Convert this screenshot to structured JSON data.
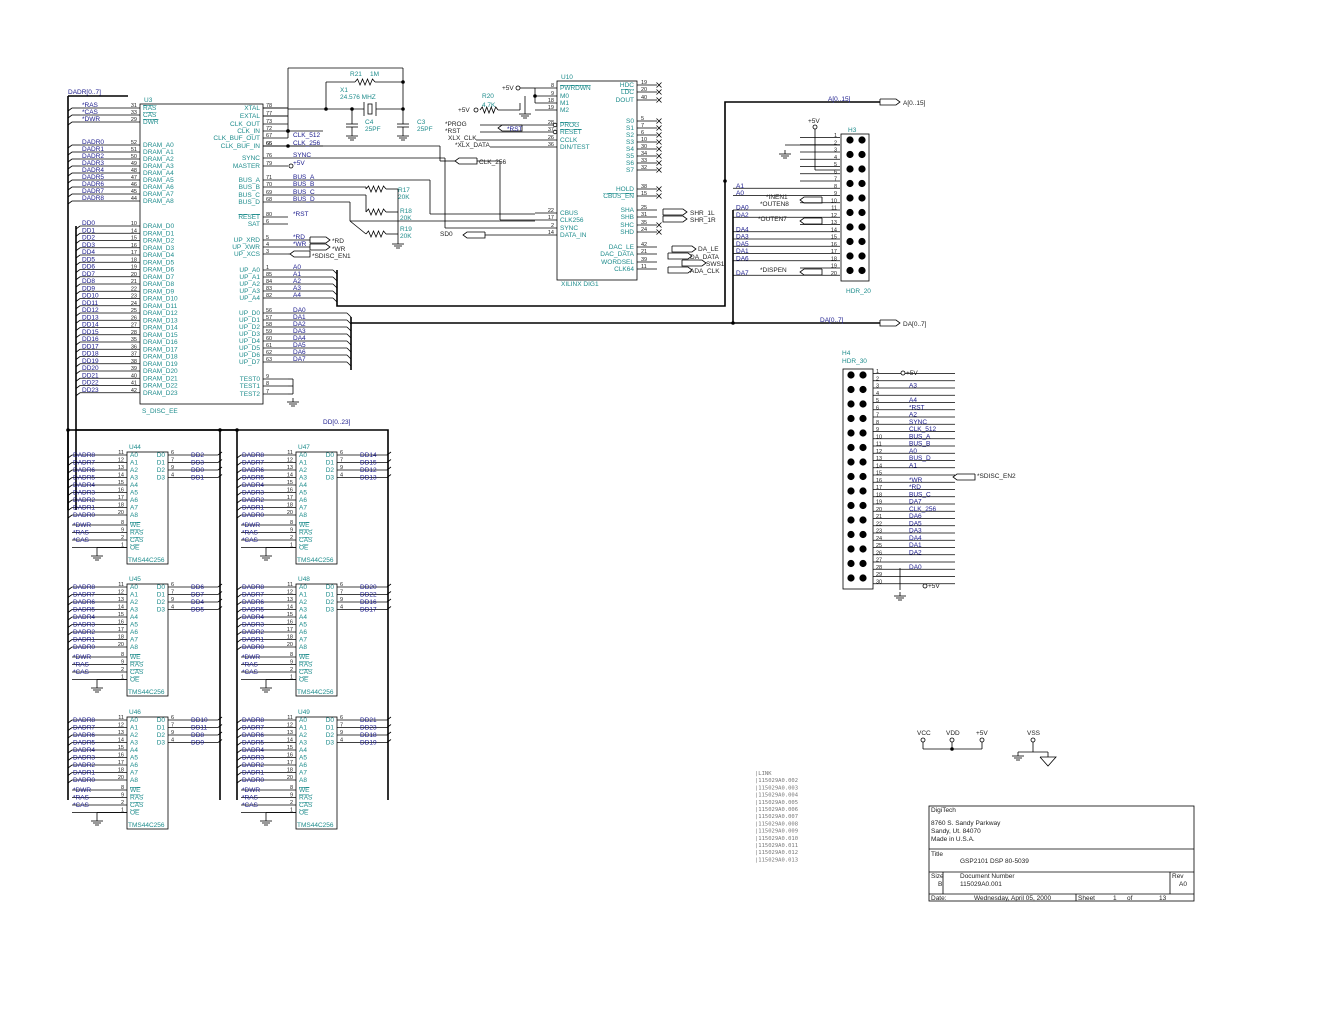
{
  "bus_labels": {
    "dadr": "DADR[0..7]",
    "dd": "DD[0..23]",
    "a": "A[0..15]",
    "a_port": "A[0..15]",
    "da": "DA[0..7]",
    "da_port": "DA[0..7]"
  },
  "u3": {
    "ref": "U3",
    "name": "S_DISC_EE",
    "left_pins": [
      {
        "num": "31",
        "label": "RAS",
        "net": "*RAS"
      },
      {
        "num": "33",
        "label": "CAS",
        "net": "*CAS"
      },
      {
        "num": "29",
        "label": "DWR",
        "net": "*DWR"
      },
      {
        "num": "52",
        "label": "DRAM_A0",
        "net": "DADR0"
      },
      {
        "num": "51",
        "label": "DRAM_A1",
        "net": "DADR1"
      },
      {
        "num": "50",
        "label": "DRAM_A2",
        "net": "DADR2"
      },
      {
        "num": "49",
        "label": "DRAM_A3",
        "net": "DADR3"
      },
      {
        "num": "48",
        "label": "DRAM_A4",
        "net": "DADR4"
      },
      {
        "num": "47",
        "label": "DRAM_A5",
        "net": "DADR5"
      },
      {
        "num": "46",
        "label": "DRAM_A6",
        "net": "DADR6"
      },
      {
        "num": "45",
        "label": "DRAM_A7",
        "net": "DADR7"
      },
      {
        "num": "44",
        "label": "DRAM_A8",
        "net": "DADR8"
      },
      {
        "num": "10",
        "label": "DRAM_D0",
        "net": "DD0"
      },
      {
        "num": "14",
        "label": "DRAM_D1",
        "net": "DD1"
      },
      {
        "num": "15",
        "label": "DRAM_D2",
        "net": "DD2"
      },
      {
        "num": "16",
        "label": "DRAM_D3",
        "net": "DD3"
      },
      {
        "num": "17",
        "label": "DRAM_D4",
        "net": "DD4"
      },
      {
        "num": "18",
        "label": "DRAM_D5",
        "net": "DD5"
      },
      {
        "num": "19",
        "label": "DRAM_D6",
        "net": "DD6"
      },
      {
        "num": "20",
        "label": "DRAM_D7",
        "net": "DD7"
      },
      {
        "num": "21",
        "label": "DRAM_D8",
        "net": "DD8"
      },
      {
        "num": "22",
        "label": "DRAM_D9",
        "net": "DD9"
      },
      {
        "num": "23",
        "label": "DRAM_D10",
        "net": "DD10"
      },
      {
        "num": "24",
        "label": "DRAM_D11",
        "net": "DD11"
      },
      {
        "num": "25",
        "label": "DRAM_D12",
        "net": "DD12"
      },
      {
        "num": "26",
        "label": "DRAM_D13",
        "net": "DD13"
      },
      {
        "num": "27",
        "label": "DRAM_D14",
        "net": "DD14"
      },
      {
        "num": "28",
        "label": "DRAM_D15",
        "net": "DD15"
      },
      {
        "num": "35",
        "label": "DRAM_D16",
        "net": "DD16"
      },
      {
        "num": "36",
        "label": "DRAM_D17",
        "net": "DD17"
      },
      {
        "num": "37",
        "label": "DRAM_D18",
        "net": "DD18"
      },
      {
        "num": "38",
        "label": "DRAM_D19",
        "net": "DD19"
      },
      {
        "num": "39",
        "label": "DRAM_D20",
        "net": "DD20"
      },
      {
        "num": "40",
        "label": "DRAM_D21",
        "net": "DD21"
      },
      {
        "num": "41",
        "label": "DRAM_D22",
        "net": "DD22"
      },
      {
        "num": "42",
        "label": "DRAM_D23",
        "net": "DD23"
      }
    ],
    "right_pins": [
      {
        "num": "78",
        "label": "XTAL",
        "net": ""
      },
      {
        "num": "77",
        "label": "EXTAL",
        "net": ""
      },
      {
        "num": "73",
        "label": "CLK_OUT",
        "net": ""
      },
      {
        "num": "72",
        "label": "CLK_IN",
        "net": ""
      },
      {
        "num": "67",
        "label": "CLK_BUF_OUT",
        "net": "CLK_512"
      },
      {
        "num": "66",
        "label": "CLK_BUF_IN",
        "net": ""
      },
      {
        "num": "65",
        "label": "",
        "net": "CLK_256"
      },
      {
        "num": "76",
        "label": "SYNC",
        "net": "SYNC"
      },
      {
        "num": "79",
        "label": "MASTER",
        "net": "+5V"
      },
      {
        "num": "71",
        "label": "BUS_A",
        "net": "BUS_A"
      },
      {
        "num": "70",
        "label": "BUS_B",
        "net": "BUS_B"
      },
      {
        "num": "69",
        "label": "BUS_C",
        "net": "BUS_C"
      },
      {
        "num": "68",
        "label": "BUS_D",
        "net": "BUS_D"
      },
      {
        "num": "80",
        "label": "RESET",
        "net": "*RST"
      },
      {
        "num": "6",
        "label": "SAT",
        "net": ""
      },
      {
        "num": "5",
        "label": "UP_XRD",
        "net": "*RD"
      },
      {
        "num": "4",
        "label": "UP_XWR",
        "net": "*WR"
      },
      {
        "num": "3",
        "label": "UP_XCS",
        "net": ""
      },
      {
        "num": "1",
        "label": "UP_A0",
        "net": "A0"
      },
      {
        "num": "85",
        "label": "UP_A1",
        "net": "A1"
      },
      {
        "num": "84",
        "label": "UP_A2",
        "net": "A2"
      },
      {
        "num": "83",
        "label": "UP_A3",
        "net": "A3"
      },
      {
        "num": "82",
        "label": "UP_A4",
        "net": "A4"
      },
      {
        "num": "56",
        "label": "UP_D0",
        "net": "DA0"
      },
      {
        "num": "57",
        "label": "UP_D1",
        "net": "DA1"
      },
      {
        "num": "58",
        "label": "UP_D2",
        "net": "DA2"
      },
      {
        "num": "59",
        "label": "UP_D3",
        "net": "DA3"
      },
      {
        "num": "60",
        "label": "UP_D4",
        "net": "DA4"
      },
      {
        "num": "61",
        "label": "UP_D5",
        "net": "DA5"
      },
      {
        "num": "62",
        "label": "UP_D6",
        "net": "DA6"
      },
      {
        "num": "63",
        "label": "UP_D7",
        "net": "DA7"
      },
      {
        "num": "9",
        "label": "TEST0",
        "net": ""
      },
      {
        "num": "8",
        "label": "TEST1",
        "net": ""
      },
      {
        "num": "7",
        "label": "TEST2",
        "net": ""
      }
    ],
    "port_rd": "*RD",
    "port_wr": "*WR",
    "port_cs": "*SDISC_EN1"
  },
  "xtal": {
    "r21": "R21",
    "r21_val": "1M",
    "x1": "X1",
    "x1_val": "24.576 MHZ",
    "c4": "C4",
    "c4_val": "25PF",
    "c3": "C3",
    "c3_val": "25PF"
  },
  "resistors": {
    "r17": "R17",
    "r17_val": "20K",
    "r18": "R18",
    "r18_val": "20K",
    "r19": "R19",
    "r19_val": "20K",
    "r20": "R20",
    "r20_val": "4.7K",
    "sd0": "SD0"
  },
  "u10": {
    "ref": "U10",
    "name": "XILINX DIG1",
    "left_pins": [
      {
        "num": "8",
        "label": "PWRDWN"
      },
      {
        "num": "9",
        "label": "M0"
      },
      {
        "num": "18",
        "label": "M1"
      },
      {
        "num": "19",
        "label": "M2"
      },
      {
        "num": "28",
        "label": "PROG"
      },
      {
        "num": "37",
        "label": "RESET"
      },
      {
        "num": "26",
        "label": "CCLK"
      },
      {
        "num": "36",
        "label": "DIN/TEST"
      },
      {
        "num": "22",
        "label": "CBUS"
      },
      {
        "num": "17",
        "label": "CLK256"
      },
      {
        "num": "2",
        "label": "SYNC"
      },
      {
        "num": "14",
        "label": "DATA_IN"
      }
    ],
    "right_pins": [
      {
        "num": "19",
        "label": "HDC"
      },
      {
        "num": "20",
        "label": "LDC"
      },
      {
        "num": "40",
        "label": "DOUT"
      },
      {
        "num": "5",
        "label": "S0"
      },
      {
        "num": "7",
        "label": "S1"
      },
      {
        "num": "6",
        "label": "S2"
      },
      {
        "num": "10",
        "label": "S3"
      },
      {
        "num": "30",
        "label": "S4"
      },
      {
        "num": "34",
        "label": "S5"
      },
      {
        "num": "33",
        "label": "S6"
      },
      {
        "num": "32",
        "label": "S7"
      },
      {
        "num": "38",
        "label": "HOLD"
      },
      {
        "num": "15",
        "label": "CBUS_EN"
      },
      {
        "num": "25",
        "label": "SHA"
      },
      {
        "num": "31",
        "label": "SHB"
      },
      {
        "num": "35",
        "label": "SHC"
      },
      {
        "num": "24",
        "label": "SHD"
      },
      {
        "num": "42",
        "label": "DAC_LE"
      },
      {
        "num": "21",
        "label": "DAC_DATA"
      },
      {
        "num": "39",
        "label": "WORDSEL"
      },
      {
        "num": "11",
        "label": "CLK64"
      }
    ],
    "nets": {
      "prog": "*PROG",
      "rst_in": "*RST",
      "rst_port": "*RST",
      "xlx_clk": "XLX_CLK",
      "xlx_data": "*XLX_DATA",
      "clk256": "CLK_256",
      "p5v_a": "+5V",
      "p5v_b": "+5V",
      "shr_1l": "SHR_1L",
      "shr_1r": "SHR_1R",
      "da_le": "DA_LE",
      "da_data": "DA_DATA",
      "sws1": "SWS1",
      "ada_clk": "ADA_CLK"
    }
  },
  "h3": {
    "ref": "H3",
    "name": "HDR_20",
    "p5v": "+5V",
    "pins": [
      "1",
      "2",
      "3",
      "4",
      "5",
      "6",
      "7",
      "8",
      "9",
      "10",
      "11",
      "12",
      "13",
      "14",
      "15",
      "16",
      "17",
      "18",
      "19",
      "20"
    ],
    "left_nets": [
      "",
      "",
      "",
      "",
      "",
      "",
      "",
      "A1",
      "A0",
      "",
      "DA0",
      "DA2",
      "",
      "DA4",
      "DA3",
      "DA5",
      "DA1",
      "DA6",
      "",
      "DA7"
    ],
    "inen1": "*INEN1",
    "outen8": "*OUTEN8",
    "outen7": "*OUTEN7",
    "dispen": "*DISPEN"
  },
  "h4": {
    "ref": "H4",
    "name": "HDR_30",
    "p5v_top": "+5V",
    "p5v_bot": "+5V",
    "pins": [
      "1",
      "2",
      "3",
      "4",
      "5",
      "6",
      "7",
      "8",
      "9",
      "10",
      "11",
      "12",
      "13",
      "14",
      "15",
      "16",
      "17",
      "18",
      "19",
      "20",
      "21",
      "22",
      "23",
      "24",
      "25",
      "26",
      "27",
      "28",
      "29",
      "30"
    ],
    "nets": [
      "",
      "",
      "A3",
      "",
      "A4",
      "*RST",
      "A2",
      "SYNC",
      "CLK_512",
      "BUS_A",
      "BUS_B",
      "A0",
      "BUS_D",
      "A1",
      "",
      "*WR",
      "*RD",
      "BUS_C",
      "DA7",
      "CLK_256",
      "DA6",
      "DA5",
      "DA3",
      "DA4",
      "DA1",
      "DA2",
      "",
      "DA0",
      "",
      ""
    ],
    "sdisc_en2": "*SDISC_EN2"
  },
  "drams": [
    {
      "ref": "U44",
      "name": "TMS44C256",
      "addr": [
        "DADR8",
        "DADR7",
        "DADR6",
        "DADR5",
        "DADR4",
        "DADR3",
        "DADR2",
        "DADR1",
        "DADR0"
      ],
      "data": [
        "DD2",
        "DD3",
        "DD0",
        "DD1"
      ],
      "ctrl": [
        "*DWR",
        "*RAS",
        "*CAS",
        ""
      ]
    },
    {
      "ref": "U47",
      "name": "TMS44C256",
      "addr": [
        "DADR8",
        "DADR7",
        "DADR6",
        "DADR5",
        "DADR4",
        "DADR3",
        "DADR2",
        "DADR1",
        "DADR0"
      ],
      "data": [
        "DD14",
        "DD15",
        "DD12",
        "DD13"
      ],
      "ctrl": [
        "*DWR",
        "*RAS",
        "*CAS",
        ""
      ]
    },
    {
      "ref": "U45",
      "name": "TMS44C256",
      "addr": [
        "DADR8",
        "DADR7",
        "DADR6",
        "DADR5",
        "DADR4",
        "DADR3",
        "DADR2",
        "DADR1",
        "DADR0"
      ],
      "data": [
        "DD6",
        "DD7",
        "DD4",
        "DD5"
      ],
      "ctrl": [
        "*DWR",
        "*RAS",
        "*CAS",
        ""
      ]
    },
    {
      "ref": "U48",
      "name": "TMS44C256",
      "addr": [
        "DADR8",
        "DADR7",
        "DADR6",
        "DADR5",
        "DADR4",
        "DADR3",
        "DADR2",
        "DADR1",
        "DADR0"
      ],
      "data": [
        "DD20",
        "DD22",
        "DD16",
        "DD17"
      ],
      "ctrl": [
        "*DWR",
        "*RAS",
        "*CAS",
        ""
      ]
    },
    {
      "ref": "U46",
      "name": "TMS44C256",
      "addr": [
        "DADR8",
        "DADR7",
        "DADR6",
        "DADR5",
        "DADR4",
        "DADR3",
        "DADR2",
        "DADR1",
        "DADR0"
      ],
      "data": [
        "DD10",
        "DD11",
        "DD8",
        "DD9"
      ],
      "ctrl": [
        "*DWR",
        "*RAS",
        "*CAS",
        ""
      ]
    },
    {
      "ref": "U49",
      "name": "TMS44C256",
      "addr": [
        "DADR8",
        "DADR7",
        "DADR6",
        "DADR5",
        "DADR4",
        "DADR3",
        "DADR2",
        "DADR1",
        "DADR0"
      ],
      "data": [
        "DD21",
        "DD23",
        "DD18",
        "DD19"
      ],
      "ctrl": [
        "*DWR",
        "*RAS",
        "*CAS",
        ""
      ]
    }
  ],
  "dram_pins": {
    "labels": [
      "A0",
      "A1",
      "A2",
      "A3",
      "A4",
      "A5",
      "A6",
      "A7",
      "A8"
    ],
    "nums": [
      "11",
      "12",
      "13",
      "14",
      "15",
      "16",
      "17",
      "18",
      "20"
    ],
    "data_labels": [
      "D0",
      "D1",
      "D2",
      "D3"
    ],
    "data_nums": [
      "6",
      "7",
      "9",
      "4"
    ],
    "ctrl_labels": [
      "WE",
      "RAS",
      "CAS",
      "OE"
    ],
    "ctrl_nums": [
      "8",
      "9",
      "2",
      "1"
    ]
  },
  "power": {
    "vcc": "VCC",
    "vdd": "VDD",
    "p5v": "+5V",
    "vss": "VSS"
  },
  "link_list": [
    "|LINK",
    "|115029A0.002",
    "|115029A0.003",
    "|115029A0.004",
    "|115029A0.005",
    "|115029A0.006",
    "|115029A0.007",
    "|115029A0.008",
    "|115029A0.009",
    "|115029A0.010",
    "|115029A0.011",
    "|115029A0.012",
    "|115029A0.013"
  ],
  "title_block": {
    "company": "DigiTech",
    "address1": "8760 S. Sandy Parkway",
    "address2": "Sandy, Ut. 84070",
    "address3": "Made in U.S.A.",
    "title_label": "Title",
    "title": "GSP2101  DSP  80-5039",
    "size_label": "Size",
    "size": "B",
    "docnum_label": "Document Number",
    "docnum": "115029A0.001",
    "rev_label": "Rev",
    "rev": "A0",
    "date_label": "Date:",
    "date": "Wednesday, April 05, 2000",
    "sheet_label": "Sheet",
    "sheet": "1",
    "of_label": "of",
    "of": "13"
  },
  "colors": {
    "wire": "#000000",
    "pin_text": "#1e8c8c",
    "net_text": "#1a1a8c"
  }
}
